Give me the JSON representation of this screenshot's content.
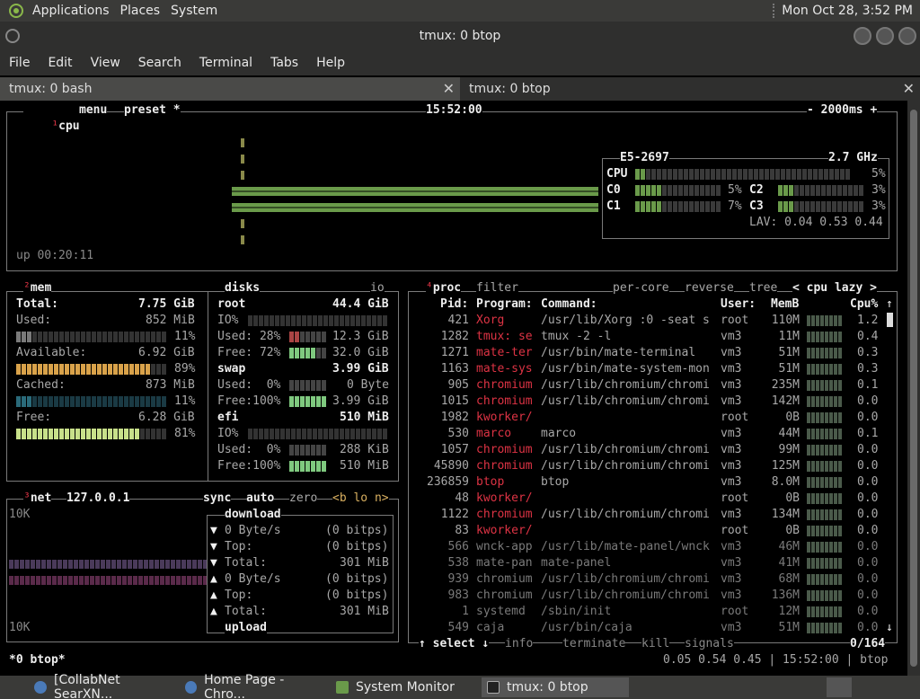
{
  "top_panel": {
    "applications": "Applications",
    "places": "Places",
    "system": "System",
    "clock": "Mon Oct 28,  3:52 PM"
  },
  "window": {
    "title": "tmux: 0 btop"
  },
  "menubar": [
    "File",
    "Edit",
    "View",
    "Search",
    "Terminal",
    "Tabs",
    "Help"
  ],
  "tabs": [
    {
      "label": "tmux: 0 bash"
    },
    {
      "label": "tmux: 0 btop"
    }
  ],
  "cpu_box": {
    "title_sup": "¹",
    "title": "cpu",
    "menu": "menu",
    "preset": "preset *",
    "time": "15:52:00",
    "interval": "- 2000ms +",
    "model": "E5-2697",
    "freq": "2.7 GHz",
    "rows": [
      {
        "label": "CPU",
        "pct": "5%"
      },
      {
        "label": "C0",
        "pct": "5%"
      },
      {
        "label": "C1",
        "pct": "7%"
      },
      {
        "label": "C2",
        "pct": "3%"
      },
      {
        "label": "C3",
        "pct": "3%"
      }
    ],
    "lav": "LAV: 0.04 0.53 0.44",
    "uptime": "up 00:20:11"
  },
  "mem_box": {
    "title_sup": "²",
    "title": "mem",
    "total_label": "Total:",
    "total": "7.75 GiB",
    "used_label": "Used:",
    "used": "852 MiB",
    "used_pct": "11%",
    "avail_label": "Available:",
    "avail": "6.92 GiB",
    "avail_pct": "89%",
    "cached_label": "Cached:",
    "cached": "873 MiB",
    "cached_pct": "11%",
    "free_label": "Free:",
    "free": "6.28 GiB",
    "free_pct": "81%",
    "bar_levels": {
      "used": 0.11,
      "avail": 0.89,
      "cached": 0.11,
      "free": 0.81
    }
  },
  "disks_box": {
    "title": "disks",
    "io": "io",
    "root_label": "root",
    "root_size": "44.4 GiB",
    "root_io": "IO%",
    "root_used": "Used: 28%",
    "root_used_val": "12.3 GiB",
    "root_free": "Free: 72%",
    "root_free_val": "32.0 GiB",
    "swap_label": "swap",
    "swap_size": "3.99 GiB",
    "swap_used": "Used:  0%",
    "swap_used_val": "0 Byte",
    "swap_free": "Free:100%",
    "swap_free_val": "3.99 GiB",
    "efi_label": "efi",
    "efi_size": "510 MiB",
    "efi_io": "IO%",
    "efi_used": "Used:  0%",
    "efi_used_val": "288 KiB",
    "efi_free": "Free:100%",
    "efi_free_val": "510 MiB"
  },
  "net_box": {
    "title_sup": "³",
    "title": "net",
    "iface": "127.0.0.1",
    "sync": "sync",
    "auto": "auto",
    "zero": "zero",
    "nav": "<b lo n>",
    "scale_top": "10K",
    "scale_bottom": "10K",
    "download": "download",
    "upload": "upload",
    "rows": [
      {
        "arrow": "▼",
        "label": "0 Byte/s",
        "val": "(0 bitps)"
      },
      {
        "arrow": "▼",
        "label": "Top:",
        "val": "(0 bitps)"
      },
      {
        "arrow": "▼",
        "label": "Total:",
        "val": "301 MiB"
      },
      {
        "arrow": "▲",
        "label": "0 Byte/s",
        "val": "(0 bitps)"
      },
      {
        "arrow": "▲",
        "label": "Top:",
        "val": "(0 bitps)"
      },
      {
        "arrow": "▲",
        "label": "Total:",
        "val": "301 MiB"
      }
    ]
  },
  "proc_box": {
    "title_sup": "⁴",
    "title": "proc",
    "filter": "filter",
    "percore": "per-core",
    "reverse": "reverse",
    "tree": "tree",
    "sort": "< cpu lazy >",
    "headers": {
      "pid": "Pid:",
      "program": "Program:",
      "command": "Command:",
      "user": "User:",
      "memb": "MemB",
      "cpu": "Cpu%"
    },
    "rows": [
      {
        "pid": "421",
        "prog": "Xorg",
        "cmd": "/usr/lib/Xorg :0 -seat s",
        "user": "root",
        "mem": "110M",
        "cpu": "1.2"
      },
      {
        "pid": "1282",
        "prog": "tmux: se",
        "cmd": "tmux -2 -l",
        "user": "vm3",
        "mem": "11M",
        "cpu": "0.4"
      },
      {
        "pid": "1271",
        "prog": "mate-ter",
        "cmd": "/usr/bin/mate-terminal",
        "user": "vm3",
        "mem": "51M",
        "cpu": "0.3"
      },
      {
        "pid": "1163",
        "prog": "mate-sys",
        "cmd": "/usr/bin/mate-system-mon",
        "user": "vm3",
        "mem": "51M",
        "cpu": "0.3"
      },
      {
        "pid": "905",
        "prog": "chromium",
        "cmd": "/usr/lib/chromium/chromi",
        "user": "vm3",
        "mem": "235M",
        "cpu": "0.1"
      },
      {
        "pid": "1015",
        "prog": "chromium",
        "cmd": "/usr/lib/chromium/chromi",
        "user": "vm3",
        "mem": "142M",
        "cpu": "0.0"
      },
      {
        "pid": "1982",
        "prog": "kworker/",
        "cmd": "",
        "user": "root",
        "mem": "0B",
        "cpu": "0.0"
      },
      {
        "pid": "530",
        "prog": "marco",
        "cmd": "marco",
        "user": "vm3",
        "mem": "44M",
        "cpu": "0.1"
      },
      {
        "pid": "1057",
        "prog": "chromium",
        "cmd": "/usr/lib/chromium/chromi",
        "user": "vm3",
        "mem": "99M",
        "cpu": "0.0"
      },
      {
        "pid": "45890",
        "prog": "chromium",
        "cmd": "/usr/lib/chromium/chromi",
        "user": "vm3",
        "mem": "125M",
        "cpu": "0.0"
      },
      {
        "pid": "236859",
        "prog": "btop",
        "cmd": "btop",
        "user": "vm3",
        "mem": "8.0M",
        "cpu": "0.0"
      },
      {
        "pid": "48",
        "prog": "kworker/",
        "cmd": "",
        "user": "root",
        "mem": "0B",
        "cpu": "0.0"
      },
      {
        "pid": "1122",
        "prog": "chromium",
        "cmd": "/usr/lib/chromium/chromi",
        "user": "vm3",
        "mem": "134M",
        "cpu": "0.0"
      },
      {
        "pid": "83",
        "prog": "kworker/",
        "cmd": "",
        "user": "root",
        "mem": "0B",
        "cpu": "0.0"
      },
      {
        "pid": "566",
        "prog": "wnck-app",
        "cmd": "/usr/lib/mate-panel/wnck",
        "user": "vm3",
        "mem": "46M",
        "cpu": "0.0"
      },
      {
        "pid": "538",
        "prog": "mate-pan",
        "cmd": "mate-panel",
        "user": "vm3",
        "mem": "41M",
        "cpu": "0.0"
      },
      {
        "pid": "939",
        "prog": "chromium",
        "cmd": "/usr/lib/chromium/chromi",
        "user": "vm3",
        "mem": "68M",
        "cpu": "0.0"
      },
      {
        "pid": "983",
        "prog": "chromium",
        "cmd": "/usr/lib/chromium/chromi",
        "user": "vm3",
        "mem": "136M",
        "cpu": "0.0"
      },
      {
        "pid": "1",
        "prog": "systemd",
        "cmd": "/sbin/init",
        "user": "root",
        "mem": "12M",
        "cpu": "0.0"
      },
      {
        "pid": "549",
        "prog": "caja",
        "cmd": "/usr/bin/caja",
        "user": "vm3",
        "mem": "51M",
        "cpu": "0.0"
      }
    ],
    "footer": {
      "select": "↑ select ↓",
      "info": "info",
      "terminate": "terminate",
      "kill": "kill",
      "signals": "signals",
      "count": "0/164"
    }
  },
  "status_line": {
    "left": "*0 btop*",
    "right": "0.05 0.54 0.45 | 15:52:00 | btop"
  },
  "taskbar": [
    {
      "label": "[CollabNet SearXN...",
      "icon": "chromium-icon"
    },
    {
      "label": "Home Page - Chro...",
      "icon": "chromium-icon"
    },
    {
      "label": "System Monitor",
      "icon": "system-monitor-icon"
    },
    {
      "label": "tmux: 0 btop",
      "icon": "terminal-icon"
    }
  ],
  "colors": {
    "panel": "#3a3a38",
    "mem_used": "#7a7a7a",
    "mem_avail": "#d9a24a",
    "mem_cached": "#2a6a7a",
    "mem_free": "#c8e08a",
    "accent_red": "#d33"
  }
}
